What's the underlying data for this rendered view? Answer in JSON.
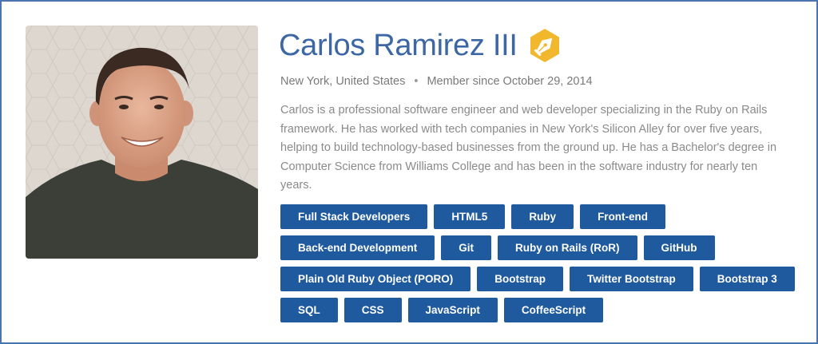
{
  "profile": {
    "name": "Carlos Ramirez III",
    "badge_icon": "pen-nib-icon",
    "location": "New York, United States",
    "separator": "•",
    "member_since": "Member since October 29, 2014",
    "bio": "Carlos is a professional software engineer and web developer specializing in the Ruby on Rails framework. He has worked with tech companies in New York's Silicon Alley for over five years, helping to build technology-based businesses from the ground up. He has a Bachelor's degree in Computer Science from Williams College and has been in the software industry for nearly ten years."
  },
  "tags": [
    [
      "Full Stack Developers",
      "HTML5",
      "Ruby",
      "Front-end"
    ],
    [
      "Back-end Development",
      "Git",
      "Ruby on Rails (RoR)",
      "GitHub"
    ],
    [
      "Plain Old Ruby Object (PORO)",
      "Bootstrap",
      "Twitter Bootstrap",
      "Bootstrap 3"
    ],
    [
      "SQL",
      "CSS",
      "JavaScript",
      "CoffeeScript"
    ]
  ],
  "colors": {
    "frame_border": "#4a74ad",
    "name": "#3d66a5",
    "tag_bg": "#1f5a9e",
    "badge": "#f2b82d"
  }
}
